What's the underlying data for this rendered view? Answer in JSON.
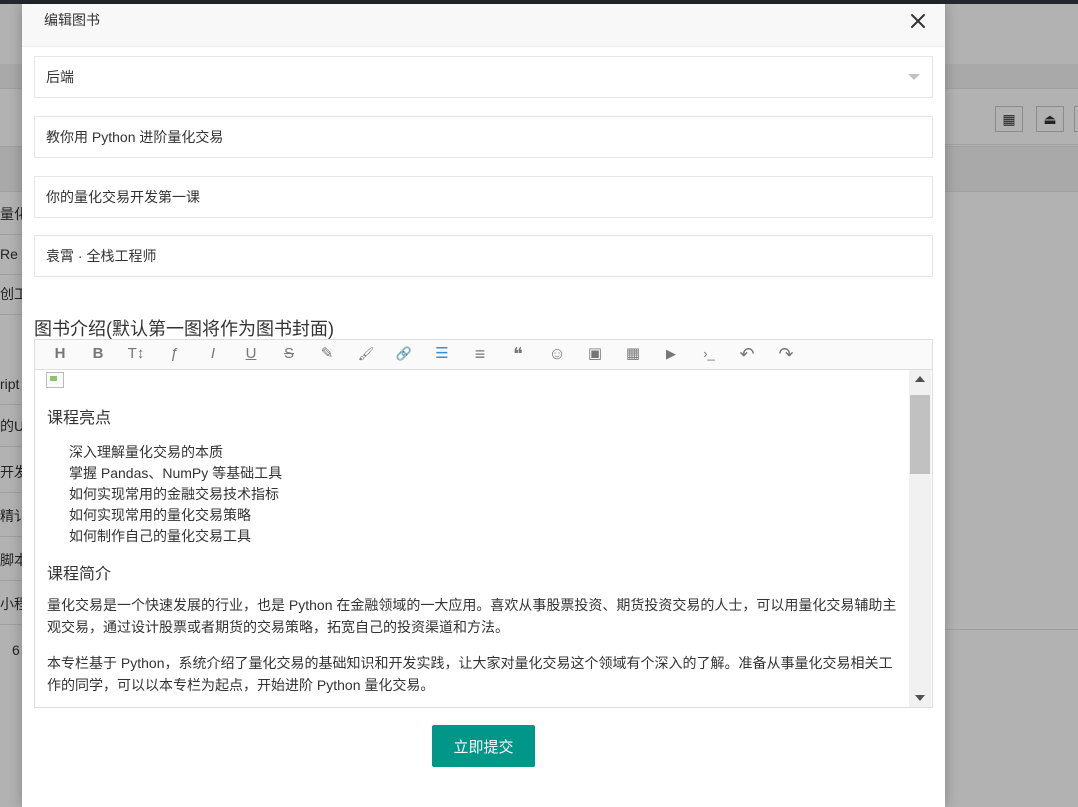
{
  "background": {
    "left_fragments": [
      "量化",
      "Re",
      "创工",
      "ript",
      "的U",
      "开发",
      "精讠",
      "脚本",
      "小程",
      "6"
    ],
    "tools": [
      "grid-icon",
      "export-icon",
      "print-icon"
    ]
  },
  "modal": {
    "title": "编辑图书",
    "close_icon": "close-icon",
    "category_value": "后端",
    "title_value": "教你用 Python 进阶量化交易",
    "subtitle_value": "你的量化交易开发第一课",
    "author_value": "袁霄 · 全栈工程师",
    "intro_label": "图书介绍(默认第一图将作为图书封面)",
    "submit_label": "立即提交"
  },
  "editor": {
    "toolbar": [
      {
        "name": "heading-icon",
        "glyph": "H"
      },
      {
        "name": "bold-icon",
        "glyph": "B"
      },
      {
        "name": "text-size-icon",
        "glyph": "T↕"
      },
      {
        "name": "font-icon",
        "glyph": "ƒ"
      },
      {
        "name": "italic-icon",
        "glyph": "I"
      },
      {
        "name": "underline-icon",
        "glyph": "U"
      },
      {
        "name": "strikethrough-icon",
        "glyph": "S"
      },
      {
        "name": "pen-icon",
        "glyph": "✎"
      },
      {
        "name": "brush-icon",
        "glyph": "🖌"
      },
      {
        "name": "link-icon",
        "glyph": "🔗"
      },
      {
        "name": "list-icon",
        "glyph": "☰"
      },
      {
        "name": "align-icon",
        "glyph": "≡"
      },
      {
        "name": "quote-icon",
        "glyph": "❝"
      },
      {
        "name": "emoji-icon",
        "glyph": "☺"
      },
      {
        "name": "image-icon",
        "glyph": "▣"
      },
      {
        "name": "table-icon",
        "glyph": "▦"
      },
      {
        "name": "video-icon",
        "glyph": "▶"
      },
      {
        "name": "code-icon",
        "glyph": "›_"
      },
      {
        "name": "undo-icon",
        "glyph": "↶"
      },
      {
        "name": "redo-icon",
        "glyph": "↷"
      }
    ],
    "highlights_heading": "课程亮点",
    "highlights": [
      "深入理解量化交易的本质",
      "掌握 Pandas、NumPy 等基础工具",
      "如何实现常用的金融交易技术指标",
      "如何实现常用的量化交易策略",
      "如何制作自己的量化交易工具"
    ],
    "intro_heading": "课程简介",
    "paragraphs": [
      "量化交易是一个快速发展的行业，也是 Python 在金融领域的一大应用。喜欢从事股票投资、期货投资交易的人士，可以用量化交易辅助主观交易，通过设计股票或者期货的交易策略，拓宽自己的投资渠道和方法。",
      "本专栏基于 Python，系统介绍了量化交易的基础知识和开发实践，让大家对量化交易这个领域有个深入的了解。准备从事量化交易相关工作的同学，可以以本专栏为起点，开始进阶 Python 量化交易。"
    ]
  },
  "colors": {
    "accent": "#009688",
    "active_tool": "#2f8fd8",
    "topbar": "#26262e"
  }
}
